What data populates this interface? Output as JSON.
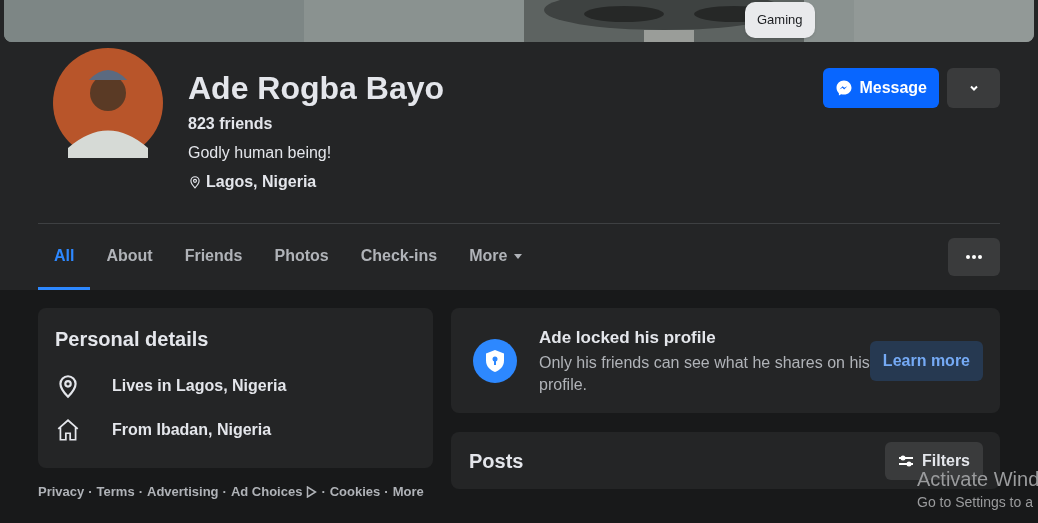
{
  "cover": {
    "kind": "picture",
    "badge": "Gaming"
  },
  "profile": {
    "name": "Ade Rogba Bayo",
    "friends": "823 friends",
    "bio": "Godly human being!",
    "location": "Lagos, Nigeria"
  },
  "actions": {
    "message": "Message"
  },
  "tabs": [
    {
      "label": "All",
      "selected": true
    },
    {
      "label": "About",
      "selected": false
    },
    {
      "label": "Friends",
      "selected": false
    },
    {
      "label": "Photos",
      "selected": false
    },
    {
      "label": "Check-ins",
      "selected": false
    },
    {
      "label": "More",
      "selected": false,
      "dropdown": true
    }
  ],
  "personal_details": {
    "title": "Personal details",
    "items": [
      {
        "kind": "location",
        "text": "Lives in Lagos, Nigeria"
      },
      {
        "kind": "home",
        "text": "From Ibadan, Nigeria"
      }
    ]
  },
  "locked_notice": {
    "title": "Ade locked his profile",
    "text": "Only his friends can see what he shares on his profile.",
    "button": "Learn more"
  },
  "posts": {
    "title": "Posts",
    "button": "Filters"
  },
  "footer": {
    "separator": "·",
    "links": [
      {
        "text": "Privacy"
      },
      {
        "text": "Terms"
      },
      {
        "text": "Advertising"
      },
      {
        "text": "Ad Choices",
        "icon": true
      },
      {
        "text": "Cookies"
      },
      {
        "text": "More"
      }
    ]
  },
  "os_overlay": {
    "title": "Activate Wind",
    "text": "Go to Settings to a"
  }
}
